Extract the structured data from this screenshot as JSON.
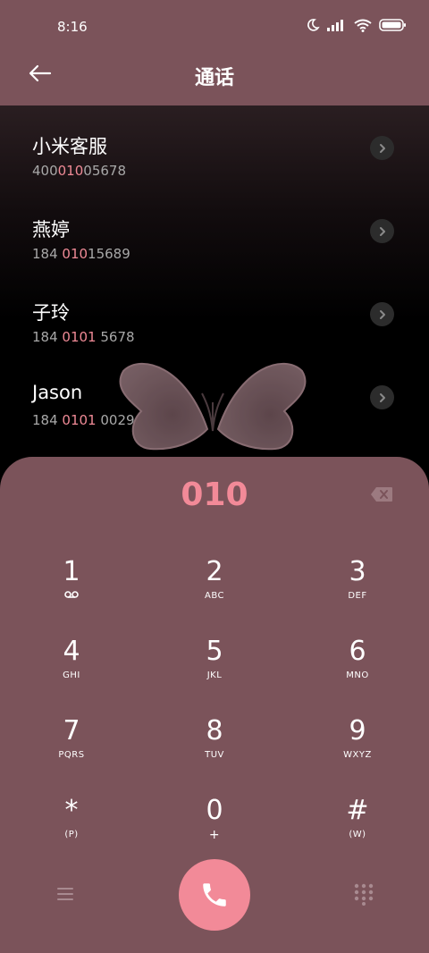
{
  "status_bar": {
    "time": "8:16"
  },
  "header": {
    "title": "通话"
  },
  "contacts": [
    {
      "name": "小米客服",
      "number_pre": "400",
      "number_hl": "010",
      "number_post": "05678"
    },
    {
      "name": "燕婷",
      "number_pre": "184 ",
      "number_hl": "010",
      "number_post": "15689"
    },
    {
      "name": "子玲",
      "number_pre": "184 ",
      "number_hl": "0101",
      "number_post": " 5678"
    },
    {
      "name": "Jason",
      "number_pre": "184 ",
      "number_hl": "0101",
      "number_post": " 0029"
    }
  ],
  "dialer": {
    "input": "010",
    "keys": [
      {
        "digit": "1",
        "letters": ""
      },
      {
        "digit": "2",
        "letters": "ABC"
      },
      {
        "digit": "3",
        "letters": "DEF"
      },
      {
        "digit": "4",
        "letters": "GHI"
      },
      {
        "digit": "5",
        "letters": "JKL"
      },
      {
        "digit": "6",
        "letters": "MNO"
      },
      {
        "digit": "7",
        "letters": "PQRS"
      },
      {
        "digit": "8",
        "letters": "TUV"
      },
      {
        "digit": "9",
        "letters": "WXYZ"
      },
      {
        "digit": "*",
        "letters": "(P)"
      },
      {
        "digit": "0",
        "letters": "+"
      },
      {
        "digit": "#",
        "letters": "(W)"
      }
    ]
  },
  "colors": {
    "panel": "#7b535a",
    "accent": "#f28a98",
    "highlight": "#ef8a96",
    "muted": "#a8a8a8"
  },
  "icons": {
    "back": "arrow-left-icon",
    "detail": "chevron-right-icon",
    "backspace": "backspace-icon",
    "voicemail": "voicemail-icon",
    "menu": "menu-icon",
    "call": "phone-icon",
    "keypad": "dialpad-icon"
  }
}
